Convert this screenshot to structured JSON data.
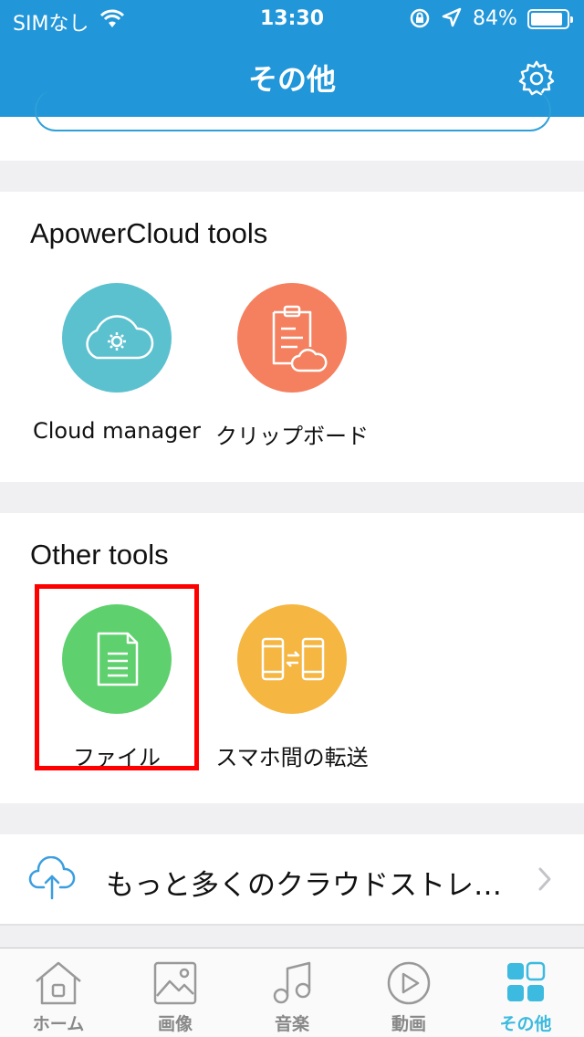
{
  "status_bar": {
    "carrier": "SIMなし",
    "time": "13:30",
    "battery": "84%",
    "battery_level": 0.84
  },
  "header": {
    "title": "その他"
  },
  "sections": [
    {
      "title": "ApowerCloud tools",
      "tools": [
        {
          "label": "Cloud manager",
          "icon": "cloud-gear-icon",
          "color": "#5bc1cf"
        },
        {
          "label": "クリップボード",
          "icon": "clipboard-cloud-icon",
          "color": "#f5805f"
        }
      ]
    },
    {
      "title": "Other tools",
      "tools": [
        {
          "label": "ファイル",
          "icon": "document-icon",
          "color": "#5fd06e"
        },
        {
          "label": "スマホ間の転送",
          "icon": "phone-transfer-icon",
          "color": "#f5b642"
        }
      ]
    }
  ],
  "cloud_storage_row": {
    "label": "もっと多くのクラウドストレ…",
    "icon": "cloud-upload-icon"
  },
  "tab_bar": {
    "tabs": [
      {
        "label": "ホーム",
        "icon": "home-icon"
      },
      {
        "label": "画像",
        "icon": "image-icon"
      },
      {
        "label": "音楽",
        "icon": "music-icon"
      },
      {
        "label": "動画",
        "icon": "video-play-icon"
      },
      {
        "label": "その他",
        "icon": "grid-icon",
        "active": true
      }
    ]
  },
  "colors": {
    "header": "#2196d9",
    "accent": "#3dbadf",
    "highlight": "#ff0000"
  }
}
